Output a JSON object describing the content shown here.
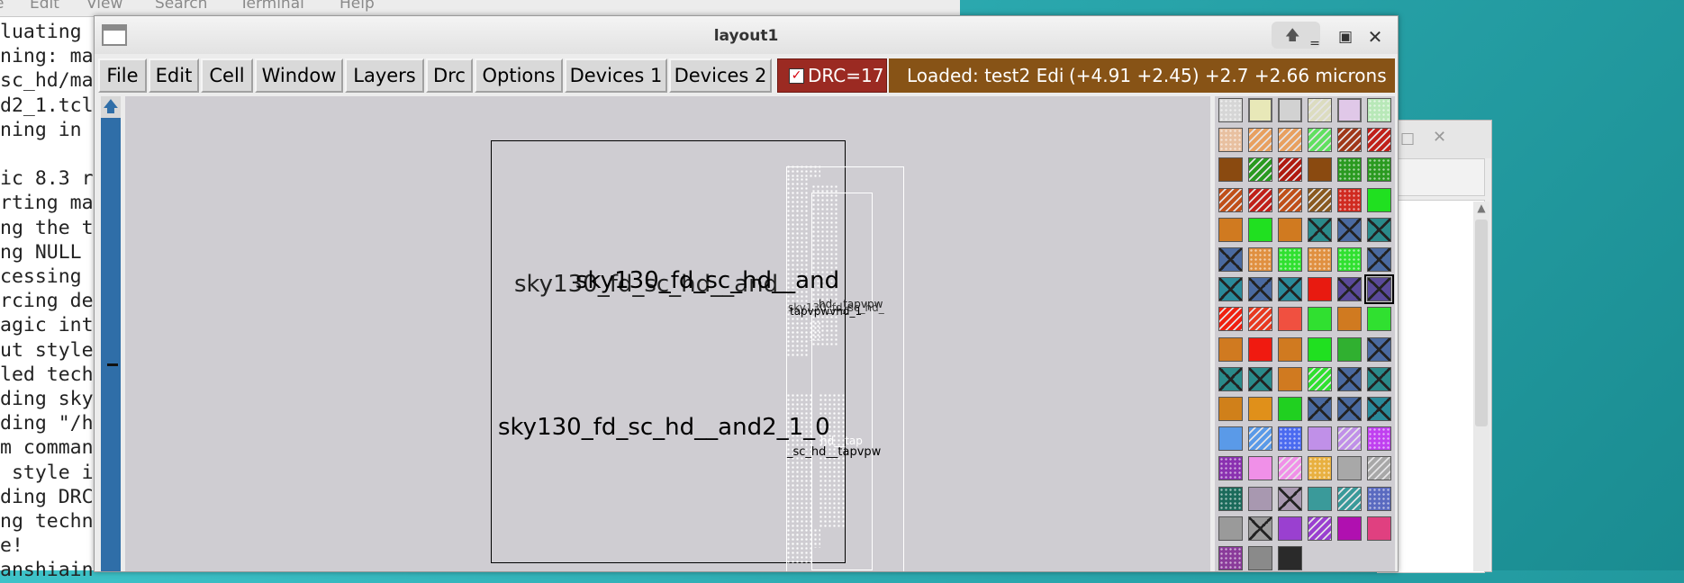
{
  "terminal": {
    "menu": [
      "e",
      "Edit",
      "View",
      "Search",
      "Terminal",
      "Help"
    ],
    "lines": [
      "luating",
      "ning: ma",
      "sc_hd/ma",
      "d2_1.tcl",
      "ning in",
      "",
      "ic 8.3 r",
      "rting ma",
      "ng the t",
      "ng NULL",
      "cessing",
      "rcing de",
      "agic int",
      "ut style",
      "led tech",
      "ding sky",
      "ding \"/h",
      "m comman",
      " style i",
      "ding DRC",
      "ng techn",
      "e!",
      "anshiain"
    ]
  },
  "window": {
    "title": "layout1"
  },
  "menubar": {
    "items": [
      "File",
      "Edit",
      "Cell",
      "Window",
      "Layers",
      "Drc",
      "Options",
      "Devices 1",
      "Devices 2"
    ],
    "drc": {
      "checked": true,
      "label": "DRC=17"
    },
    "status": {
      "loaded": "Loaded: test2 Edi",
      "coords": "(+4.91 +2.45) +2.7 +2.66 microns"
    }
  },
  "canvas": {
    "labels": {
      "cell_top_a": "sky130_fd_sc_hd__and",
      "cell_top_b": "sky130_fd_sc_hd__and",
      "cell_bottom": "sky130_fd_sc_hd__and2_1_0",
      "tap_top": "hd__tapvpw",
      "tap_top_b": "sky130_fd_sc_hd_",
      "tap_top_c": "tapvpwvhd_1",
      "tap_bottom": "_sc_hd__tapvpw",
      "tap_bottom_b": "hd__tap"
    }
  },
  "palette": {
    "selected_index": 41,
    "swatches": [
      {
        "c": "#d6d6d6",
        "p": "dots"
      },
      {
        "c": "#e8e8b8",
        "p": "outline"
      },
      {
        "c": "#d2d2d2",
        "p": "outline"
      },
      {
        "c": "#dcdcc0",
        "p": "hatch"
      },
      {
        "c": "#e0c8e8",
        "p": "outline"
      },
      {
        "c": "#b8e8b8",
        "p": "dots"
      },
      {
        "c": "#e8c0a0",
        "p": "dots"
      },
      {
        "c": "#e8a060",
        "p": "hatch"
      },
      {
        "c": "#e8a060",
        "p": "hatch"
      },
      {
        "c": "#60e060",
        "p": "hatch"
      },
      {
        "c": "#a0381a",
        "p": "hatch"
      },
      {
        "c": "#c0201a",
        "p": "hatch"
      },
      {
        "c": "#8a4a10",
        "p": "solid"
      },
      {
        "c": "#2a9a20",
        "p": "hatch"
      },
      {
        "c": "#b01a10",
        "p": "hatch"
      },
      {
        "c": "#8a4a10",
        "p": "solid"
      },
      {
        "c": "#2a9a20",
        "p": "dots"
      },
      {
        "c": "#2a9a20",
        "p": "dots"
      },
      {
        "c": "#c0501a",
        "p": "hatch"
      },
      {
        "c": "#c0201a",
        "p": "hatch"
      },
      {
        "c": "#c0501a",
        "p": "hatch"
      },
      {
        "c": "#8a5a20",
        "p": "hatch"
      },
      {
        "c": "#d02a20",
        "p": "dots"
      },
      {
        "c": "#20e020",
        "p": "solid"
      },
      {
        "c": "#d07a20",
        "p": "solid"
      },
      {
        "c": "#20e020",
        "p": "solid"
      },
      {
        "c": "#d07a20",
        "p": "solid"
      },
      {
        "c": "#2a8a8a",
        "p": "cross"
      },
      {
        "c": "#4a6aa0",
        "p": "cross"
      },
      {
        "c": "#2a8a8a",
        "p": "cross"
      },
      {
        "c": "#4a6aa0",
        "p": "cross"
      },
      {
        "c": "#e09040",
        "p": "dots"
      },
      {
        "c": "#30e030",
        "p": "dots"
      },
      {
        "c": "#e09040",
        "p": "dots"
      },
      {
        "c": "#30e030",
        "p": "dots"
      },
      {
        "c": "#4a6aa0",
        "p": "cross"
      },
      {
        "c": "#2a8a9a",
        "p": "cross"
      },
      {
        "c": "#4a6aa0",
        "p": "cross"
      },
      {
        "c": "#2a8a9a",
        "p": "cross"
      },
      {
        "c": "#e81a10",
        "p": "solid"
      },
      {
        "c": "#5a4a9a",
        "p": "cross"
      },
      {
        "c": "#5a4a9a",
        "p": "cross"
      },
      {
        "c": "#f02010",
        "p": "hatch"
      },
      {
        "c": "#e83a20",
        "p": "hatch"
      },
      {
        "c": "#f05040",
        "p": "solid"
      },
      {
        "c": "#30e030",
        "p": "solid"
      },
      {
        "c": "#d07a20",
        "p": "solid"
      },
      {
        "c": "#30e030",
        "p": "solid"
      },
      {
        "c": "#d07a20",
        "p": "solid"
      },
      {
        "c": "#f01a10",
        "p": "solid"
      },
      {
        "c": "#d07a20",
        "p": "solid"
      },
      {
        "c": "#20e020",
        "p": "solid"
      },
      {
        "c": "#30b030",
        "p": "solid"
      },
      {
        "c": "#4a6aa0",
        "p": "cross"
      },
      {
        "c": "#2a8a8a",
        "p": "cross"
      },
      {
        "c": "#2a8a8a",
        "p": "cross"
      },
      {
        "c": "#d07a20",
        "p": "solid"
      },
      {
        "c": "#30e030",
        "p": "hatch"
      },
      {
        "c": "#4a6aa0",
        "p": "cross"
      },
      {
        "c": "#2a8a8a",
        "p": "cross"
      },
      {
        "c": "#d0801a",
        "p": "solid"
      },
      {
        "c": "#e0901a",
        "p": "solid"
      },
      {
        "c": "#20d020",
        "p": "solid"
      },
      {
        "c": "#4a6aa0",
        "p": "cross"
      },
      {
        "c": "#4a6aa0",
        "p": "cross"
      },
      {
        "c": "#2a8a9a",
        "p": "cross"
      },
      {
        "c": "#5a9ae8",
        "p": "solid"
      },
      {
        "c": "#5a9ae8",
        "p": "hatch"
      },
      {
        "c": "#4a6af0",
        "p": "dots"
      },
      {
        "c": "#c090e8",
        "p": "solid"
      },
      {
        "c": "#c090e8",
        "p": "hatch"
      },
      {
        "c": "#c040f0",
        "p": "dots"
      },
      {
        "c": "#8a30b0",
        "p": "dots"
      },
      {
        "c": "#f090e8",
        "p": "solid"
      },
      {
        "c": "#f090e8",
        "p": "hatch"
      },
      {
        "c": "#e8b040",
        "p": "dots"
      },
      {
        "c": "#a8a8a8",
        "p": "solid"
      },
      {
        "c": "#a8a8a8",
        "p": "hatch"
      },
      {
        "c": "#1a6a5a",
        "p": "dots"
      },
      {
        "c": "#a898b0",
        "p": "solid"
      },
      {
        "c": "#a898b0",
        "p": "cross"
      },
      {
        "c": "#3a9a9a",
        "p": "solid"
      },
      {
        "c": "#3a9a9a",
        "p": "hatch"
      },
      {
        "c": "#5a6ac0",
        "p": "dots"
      },
      {
        "c": "#9a9a9a",
        "p": "solid"
      },
      {
        "c": "#9a9a9a",
        "p": "cross"
      },
      {
        "c": "#9a40d0",
        "p": "solid"
      },
      {
        "c": "#9a40d0",
        "p": "hatch"
      },
      {
        "c": "#b010b0",
        "p": "solid"
      },
      {
        "c": "#e04080",
        "p": "solid"
      },
      {
        "c": "#8a3a9a",
        "p": "dots"
      },
      {
        "c": "#8a8a8a",
        "p": "solid"
      },
      {
        "c": "#2a2a2a",
        "p": "solid"
      }
    ]
  }
}
